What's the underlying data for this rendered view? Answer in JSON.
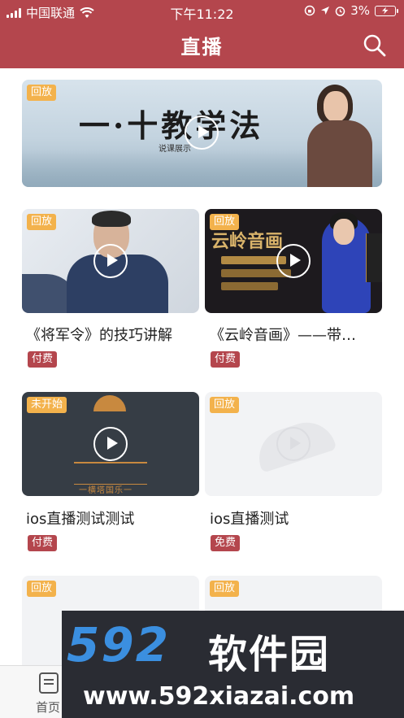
{
  "status_bar": {
    "carrier": "中国联通",
    "time": "下午11:22",
    "battery": "3%"
  },
  "nav": {
    "title": "直播",
    "search_icon": "search-icon"
  },
  "banner": {
    "badge": "回放",
    "art_text": "一·十教学法",
    "art_subtext": "说课展示"
  },
  "cards": [
    {
      "badge": "回放",
      "title": "《将军令》的技巧讲解",
      "price": "付费",
      "price_color": "#b4464d"
    },
    {
      "badge": "回放",
      "title": "《云岭音画》——带…",
      "price": "付费",
      "price_color": "#b4464d",
      "poster_title": "云岭音画"
    },
    {
      "badge": "未开始",
      "title": "ios直播测试测试",
      "price": "付费",
      "price_color": "#b4464d",
      "poster_caption": "一横塔国乐一"
    },
    {
      "badge": "回放",
      "title": "ios直播测试",
      "price": "免费",
      "price_color": "#b4464d"
    },
    {
      "badge": "回放"
    },
    {
      "badge": "回放"
    }
  ],
  "tab_bar": {
    "home_label": "首页"
  },
  "watermark": {
    "number": "592",
    "name": "软件园",
    "url": "www.592xiazai.com"
  },
  "colors": {
    "brand": "#b4464d",
    "badge": "#f3b24c"
  }
}
